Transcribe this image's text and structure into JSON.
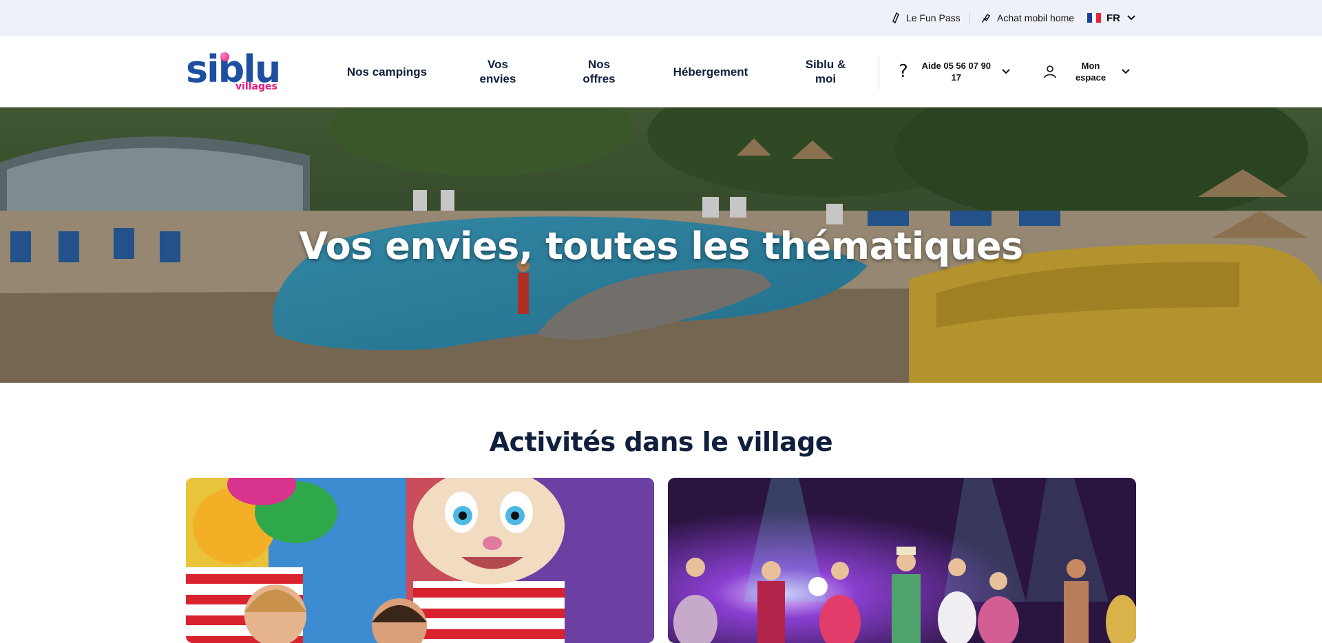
{
  "utility_bar": {
    "fun_pass": {
      "label": "Le Fun Pass",
      "icon": "ticket-icon"
    },
    "mobil_home": {
      "label": "Achat mobil home",
      "icon": "key-hand-icon"
    },
    "language": {
      "label": "FR",
      "icon": "france-flag-icon"
    }
  },
  "header": {
    "logo": {
      "main": "siblu",
      "sub": "villages"
    },
    "nav": [
      {
        "label": "Nos campings"
      },
      {
        "label": "Vos envies"
      },
      {
        "label": "Nos offres"
      },
      {
        "label": "Hébergement"
      },
      {
        "label": "Siblu & moi"
      }
    ],
    "help": {
      "label": "Aide 05 56 07 90 17",
      "icon": "question-icon"
    },
    "account": {
      "label": "Mon espace",
      "icon": "user-icon"
    }
  },
  "hero": {
    "title": "Vos envies, toutes les thématiques"
  },
  "section": {
    "title": "Activités dans le village"
  },
  "colors": {
    "navy": "#0f1f3d",
    "brand_blue": "#1e4fa0",
    "brand_pink": "#e8147a",
    "utility_bg": "#eef1f8"
  }
}
